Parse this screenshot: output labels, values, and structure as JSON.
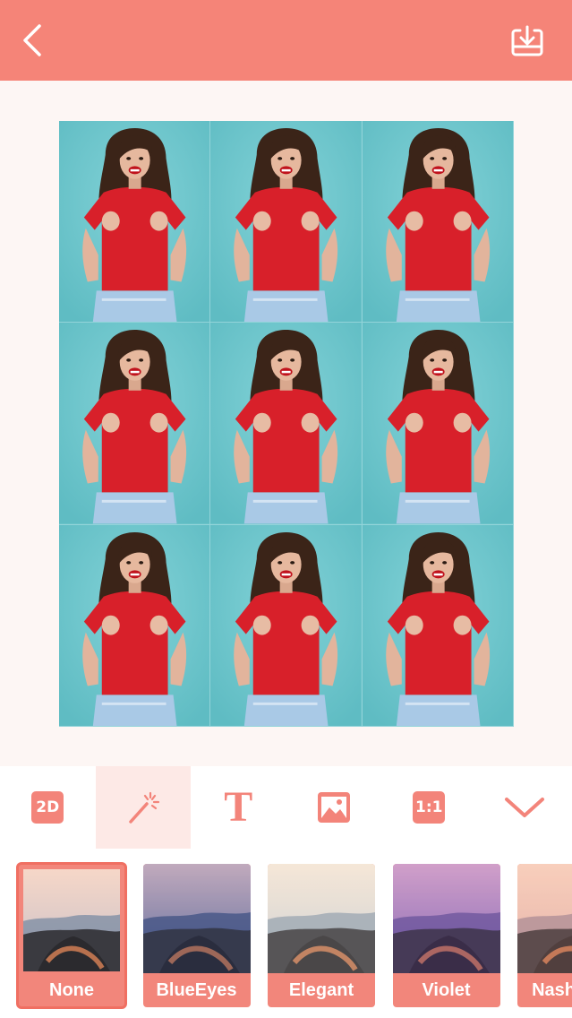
{
  "toolbar": {
    "items": [
      {
        "name": "2d",
        "label": "2D"
      },
      {
        "name": "magic-wand"
      },
      {
        "name": "text",
        "label": "T"
      },
      {
        "name": "image"
      },
      {
        "name": "ratio",
        "label": "1:1"
      },
      {
        "name": "collapse"
      }
    ],
    "active_index": 1
  },
  "filters": [
    {
      "label": "None",
      "selected": true
    },
    {
      "label": "BlueEyes",
      "selected": false
    },
    {
      "label": "Elegant",
      "selected": false
    },
    {
      "label": "Violet",
      "selected": false
    },
    {
      "label": "Nashville",
      "selected": false
    }
  ],
  "colors": {
    "accent": "#f58478",
    "photo_bg": "#6fc6cc",
    "shirt": "#d8202a"
  },
  "icons": {
    "back": "chevron-left-icon",
    "save": "download-tray-icon"
  }
}
